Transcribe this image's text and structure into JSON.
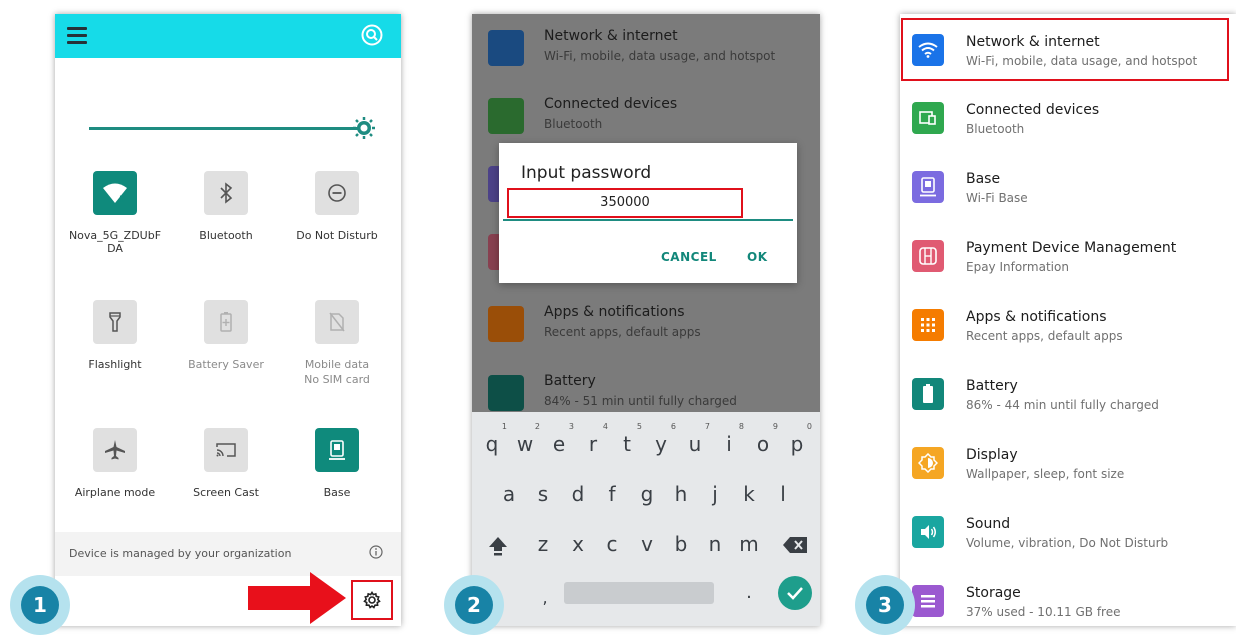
{
  "steps": [
    "1",
    "2",
    "3"
  ],
  "colors": {
    "header_cyan": "#16dbe8",
    "teal": "#0f8a7c",
    "highlight_red": "#e0101b",
    "badge_blue": "#1883a6"
  },
  "quick_settings": {
    "tiles": [
      {
        "label": "Nova_5G_ZDUbF",
        "label2": "DA",
        "icon": "wifi-icon",
        "active": true
      },
      {
        "label": "Bluetooth",
        "icon": "bluetooth-icon",
        "active": false
      },
      {
        "label": "Do Not Disturb",
        "icon": "do-not-disturb-icon",
        "active": false
      },
      {
        "label": "Flashlight",
        "icon": "flashlight-icon",
        "active": false
      },
      {
        "label": "Battery Saver",
        "icon": "battery-saver-icon",
        "active": false
      },
      {
        "label": "Mobile data",
        "sub": "No SIM card",
        "icon": "mobile-data-icon",
        "active": false
      },
      {
        "label": "Airplane mode",
        "icon": "airplane-icon",
        "active": false
      },
      {
        "label": "Screen Cast",
        "icon": "cast-icon",
        "active": false
      },
      {
        "label": "Base",
        "icon": "base-icon",
        "active": true
      }
    ],
    "footer_text": "Device is managed by your organization"
  },
  "dialog": {
    "title": "Input password",
    "password": "350000",
    "cancel": "CANCEL",
    "ok": "OK"
  },
  "dimmed_settings": [
    {
      "title": "Network & internet",
      "sub": "Wi-Fi, mobile, data usage, and hotspot"
    },
    {
      "title": "Connected devices",
      "sub": "Bluetooth"
    },
    {
      "title": "Apps & notifications",
      "sub": "Recent apps, default apps"
    },
    {
      "title": "Battery",
      "sub": "84% - 51 min until fully charged"
    }
  ],
  "keyboard": {
    "row1": [
      "q",
      "w",
      "e",
      "r",
      "t",
      "y",
      "u",
      "i",
      "o",
      "p"
    ],
    "row1_nums": [
      "1",
      "2",
      "3",
      "4",
      "5",
      "6",
      "7",
      "8",
      "9",
      "0"
    ],
    "row2": [
      "a",
      "s",
      "d",
      "f",
      "g",
      "h",
      "j",
      "k",
      "l"
    ],
    "row3": [
      "z",
      "x",
      "c",
      "v",
      "b",
      "n",
      "m"
    ],
    "comma": ",",
    "period": "."
  },
  "settings": [
    {
      "title": "Network & internet",
      "sub": "Wi-Fi, mobile, data usage, and hotspot",
      "icon": "wifi-icon",
      "color": "#1a73e8"
    },
    {
      "title": "Connected devices",
      "sub": "Bluetooth",
      "icon": "devices-icon",
      "color": "#2fa84f"
    },
    {
      "title": "Base",
      "sub": "Wi-Fi Base",
      "icon": "base-icon",
      "color": "#7b6be0"
    },
    {
      "title": "Payment Device Management",
      "sub": "Epay Information",
      "icon": "payment-device-icon",
      "color": "#e05a72"
    },
    {
      "title": "Apps & notifications",
      "sub": "Recent apps, default apps",
      "icon": "apps-icon",
      "color": "#f57c00"
    },
    {
      "title": "Battery",
      "sub": "86% - 44 min until fully charged",
      "icon": "battery-icon",
      "color": "#12877a"
    },
    {
      "title": "Display",
      "sub": "Wallpaper, sleep, font size",
      "icon": "display-icon",
      "color": "#f5a623"
    },
    {
      "title": "Sound",
      "sub": "Volume, vibration, Do Not Disturb",
      "icon": "sound-icon",
      "color": "#1aa6a0"
    },
    {
      "title": "Storage",
      "sub": "37% used - 10.11 GB free",
      "icon": "storage-icon",
      "color": "#9b59d0"
    }
  ]
}
